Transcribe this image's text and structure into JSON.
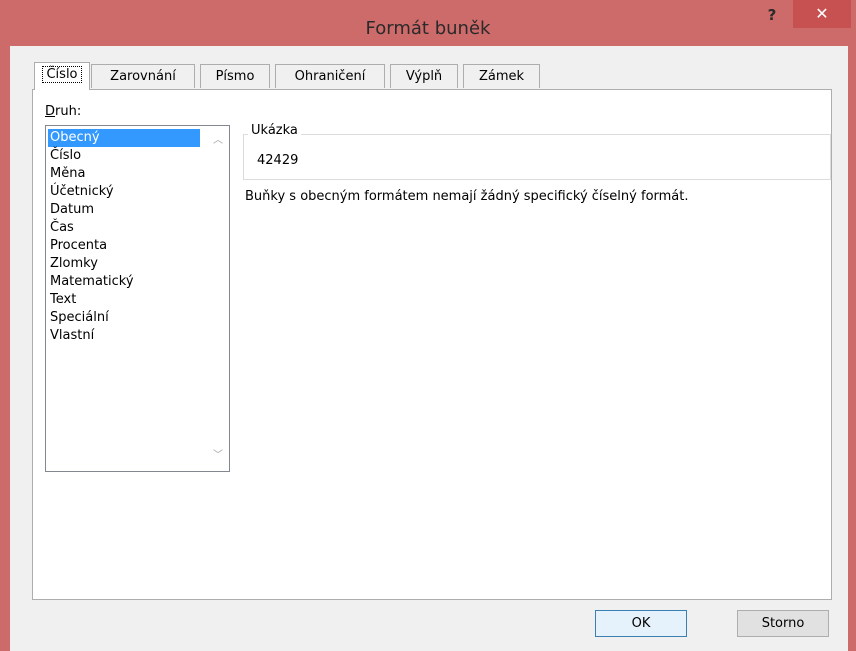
{
  "window": {
    "title": "Formát buněk",
    "help_label": "?",
    "close_label": "✕",
    "frame_color": "#cd6a6a"
  },
  "tabs": [
    {
      "label": "Číslo",
      "active": true
    },
    {
      "label": "Zarovnání",
      "active": false
    },
    {
      "label": "Písmo",
      "active": false
    },
    {
      "label": "Ohraničení",
      "active": false
    },
    {
      "label": "Výplň",
      "active": false
    },
    {
      "label": "Zámek",
      "active": false
    }
  ],
  "category": {
    "label_underlined": "D",
    "label_rest": "ruh:",
    "items": [
      "Obecný",
      "Číslo",
      "Měna",
      "Účetnický",
      "Datum",
      "Čas",
      "Procenta",
      "Zlomky",
      "Matematický",
      "Text",
      "Speciální",
      "Vlastní"
    ],
    "selected": "Obecný",
    "scroll_up_icon": "chevron-up-icon",
    "scroll_down_icon": "chevron-down-icon"
  },
  "sample": {
    "legend": "Ukázka",
    "value": "42429"
  },
  "description": "Buňky s obecným formátem nemají žádný specifický číselný formát.",
  "buttons": {
    "ok": "OK",
    "cancel": "Storno"
  }
}
